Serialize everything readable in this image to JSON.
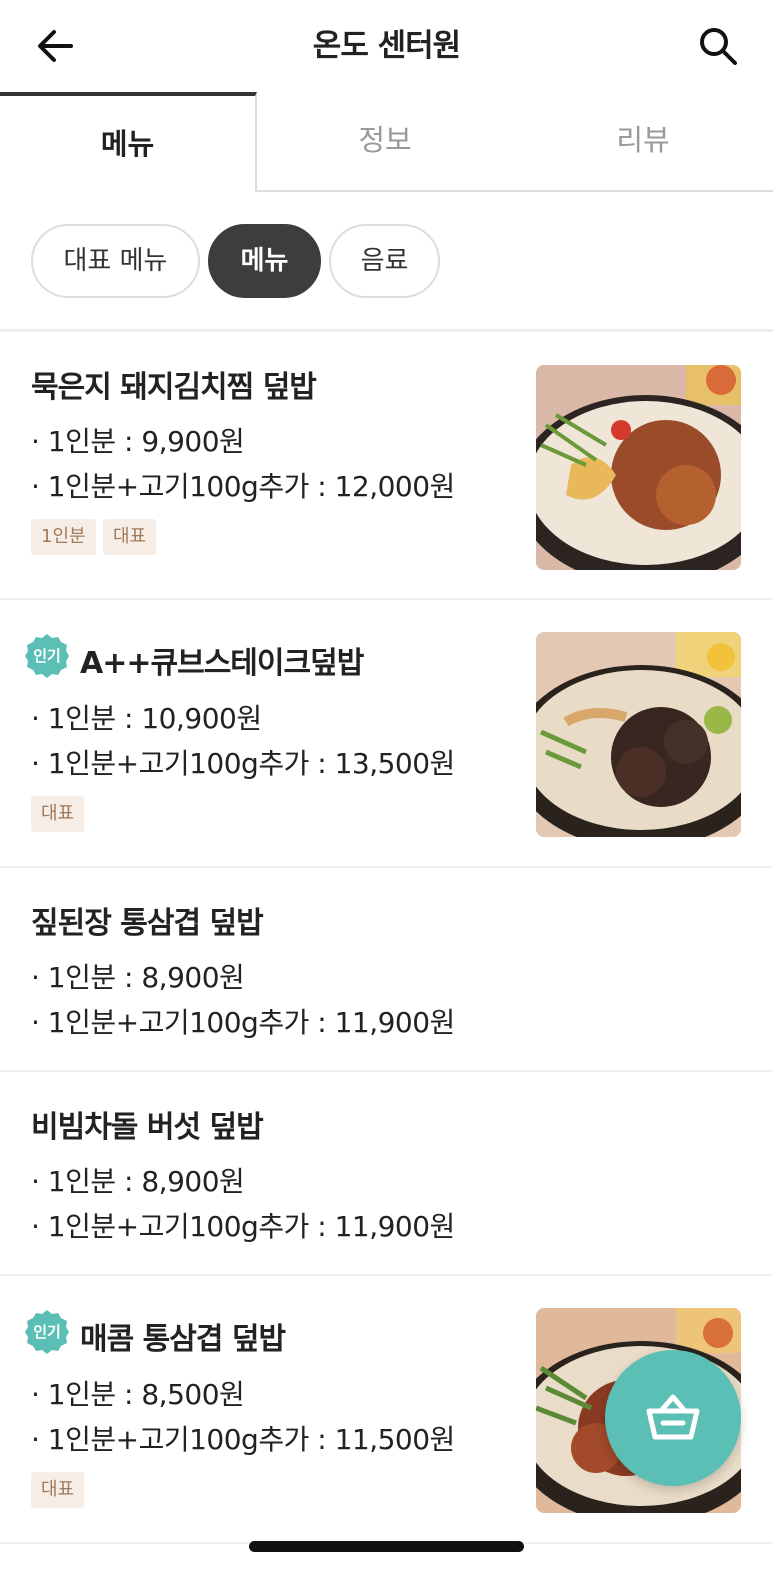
{
  "header": {
    "title": "온도 센터원"
  },
  "tabs": [
    {
      "label": "메뉴",
      "active": true
    },
    {
      "label": "정보",
      "active": false
    },
    {
      "label": "리뷰",
      "active": false
    }
  ],
  "categories": [
    {
      "label": "대표 메뉴",
      "selected": false
    },
    {
      "label": "메뉴",
      "selected": true
    },
    {
      "label": "음료",
      "selected": false
    }
  ],
  "popular_label": "인기",
  "menu_items": [
    {
      "name": "묵은지 돼지김치찜 덮밥",
      "popular": false,
      "prices": [
        "· 1인분 : 9,900원",
        "· 1인분+고기100g추가 : 12,000원"
      ],
      "tags": [
        "1인분",
        "대표"
      ],
      "has_image": true
    },
    {
      "name": "A++큐브스테이크덮밥",
      "popular": true,
      "prices": [
        "· 1인분 : 10,900원",
        "· 1인분+고기100g추가 : 13,500원"
      ],
      "tags": [
        "대표"
      ],
      "has_image": true
    },
    {
      "name": "짚된장 통삼겹 덮밥",
      "popular": false,
      "prices": [
        "· 1인분 : 8,900원",
        "· 1인분+고기100g추가 : 11,900원"
      ],
      "tags": [],
      "has_image": false
    },
    {
      "name": "비빔차돌 버섯 덮밥",
      "popular": false,
      "prices": [
        "· 1인분 : 8,900원",
        "· 1인분+고기100g추가 : 11,900원"
      ],
      "tags": [],
      "has_image": false
    },
    {
      "name": "매콤 통삼겹 덮밥",
      "popular": true,
      "prices": [
        "· 1인분 : 8,500원",
        "· 1인분+고기100g추가 : 11,500원"
      ],
      "tags": [
        "대표"
      ],
      "has_image": true
    }
  ],
  "icons": {
    "back": "arrow-left-icon",
    "search": "search-icon",
    "cart": "basket-icon",
    "popular": "popular-badge-icon"
  },
  "colors": {
    "accent": "#5bbfb5",
    "chip_selected": "#3d3d3d",
    "tag_bg": "#f5ede6",
    "tag_text": "#a07a5a"
  }
}
